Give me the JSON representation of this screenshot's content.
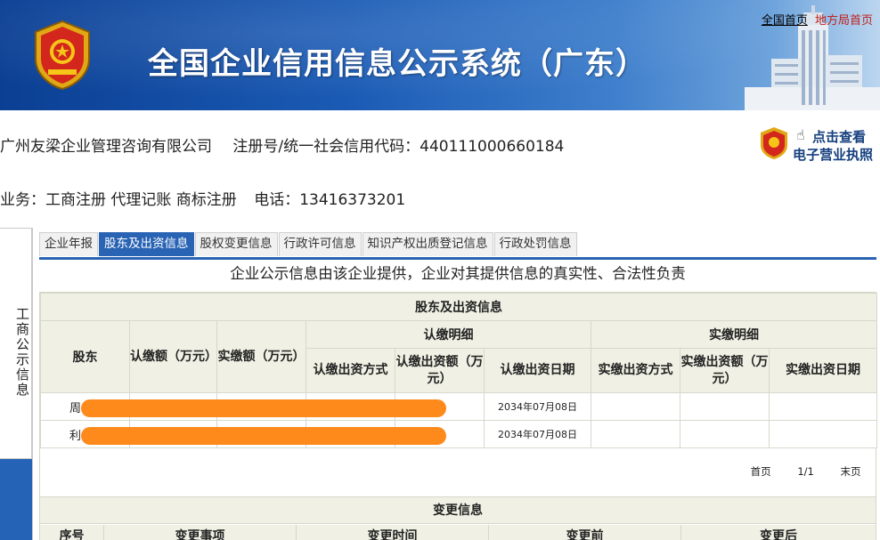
{
  "header": {
    "title": "全国企业信用信息公示系统（广东）",
    "links": {
      "home": "全国首页",
      "local": "地方局首页"
    }
  },
  "company": {
    "name": "广州友梁企业管理咨询有限公司",
    "reg_label": "注册号/统一社会信用代码：440111000660184",
    "business": "业务：工商注册 代理记账 商标注册",
    "phone": "电话：13416373201"
  },
  "license_link": {
    "line1": "点击查看",
    "line2": "电子营业执照"
  },
  "side_nav": {
    "item1": "工商公示信息"
  },
  "tabs": [
    {
      "label": "企业年报",
      "active": false
    },
    {
      "label": "股东及出资信息",
      "active": true
    },
    {
      "label": "股权变更信息",
      "active": false
    },
    {
      "label": "行政许可信息",
      "active": false
    },
    {
      "label": "知识产权出质登记信息",
      "active": false
    },
    {
      "label": "行政处罚信息",
      "active": false
    }
  ],
  "notice": "企业公示信息由该企业提供，企业对其提供信息的真实性、合法性负责",
  "shareholder_table": {
    "caption": "股东及出资信息",
    "col_shareholder": "股东",
    "col_subscribed": "认缴额（万元）",
    "col_paid": "实缴额（万元）",
    "group_subscribed": "认缴明细",
    "group_paid": "实缴明细",
    "sub_method": "认缴出资方式",
    "sub_amount": "认缴出资额（万元）",
    "sub_date": "认缴出资日期",
    "paid_method": "实缴出资方式",
    "paid_amount": "实缴出资额（万元）",
    "paid_date": "实缴出资日期",
    "rows": [
      {
        "name": "周",
        "sub_date": "2034年07月08日"
      },
      {
        "name": "利",
        "sub_date": "2034年07月08日"
      }
    ],
    "pager": {
      "first": "首页",
      "page": "1/1",
      "last": "末页"
    }
  },
  "change_table": {
    "caption": "变更信息",
    "cols": [
      "序号",
      "变更事项",
      "变更时间",
      "变更前",
      "变更后"
    ]
  },
  "colors": {
    "tab_active": "#2863b4",
    "redaction": "#ff8a1c",
    "header_bg": "#f0f1e4"
  }
}
